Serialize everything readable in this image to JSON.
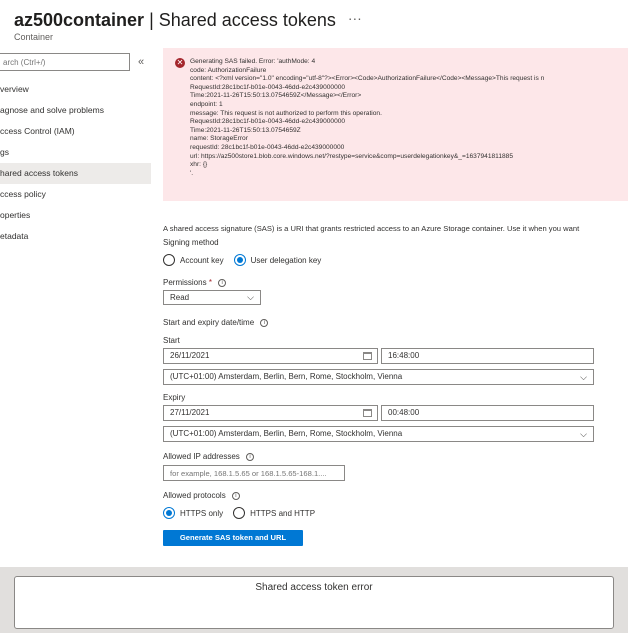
{
  "header": {
    "title": "az500container",
    "separator": "|",
    "page": "Shared access tokens",
    "more": "···",
    "subtitle": "Container"
  },
  "sidebar": {
    "search_placeholder": "arch (Ctrl+/)",
    "collapse": "«",
    "items": [
      {
        "label": "verview"
      },
      {
        "label": "agnose and solve problems"
      },
      {
        "label": "ccess Control (IAM)"
      },
      {
        "label": "gs"
      },
      {
        "label": "hared access tokens"
      },
      {
        "label": "ccess policy"
      },
      {
        "label": "operties"
      },
      {
        "label": "etadata"
      }
    ]
  },
  "error": {
    "icon": "error-circle-icon",
    "lines": [
      "Generating SAS failed. Error: 'authMode: 4",
      "code: AuthorizationFailure",
      "content: <?xml version=\"1.0\" encoding=\"utf-8\"?><Error><Code>AuthorizationFailure</Code><Message>This request is n",
      "RequestId:28c1bc1f-b01e-0043-46dd-e2c439000000",
      "Time:2021-11-26T15:50:13.0754659Z</Message></Error>",
      "endpoint: 1",
      "message: This request is not authorized to perform this operation.",
      "RequestId:28c1bc1f-b01e-0043-46dd-e2c439000000",
      "Time:2021-11-26T15:50:13.0754659Z",
      "name: StorageError",
      "requestId: 28c1bc1f-b01e-0043-46dd-e2c439000000",
      "url: https://az500store1.blob.core.windows.net/?restype=service&comp=userdelegationkey&_=1637941811885",
      "xhr: {}",
      "'."
    ]
  },
  "form": {
    "description": "A shared access signature (SAS) is a URI that grants restricted access to an Azure Storage container. Use it when you want",
    "signing_method": {
      "label": "Signing method",
      "options": [
        "Account key",
        "User delegation key"
      ],
      "selected": "User delegation key"
    },
    "permissions": {
      "label": "Permissions",
      "required": "*",
      "value": "Read"
    },
    "date_time_label": "Start and expiry date/time",
    "start": {
      "label": "Start",
      "date": "26/11/2021",
      "time": "16:48:00",
      "timezone": "(UTC+01:00) Amsterdam, Berlin, Bern, Rome, Stockholm, Vienna"
    },
    "expiry": {
      "label": "Expiry",
      "date": "27/11/2021",
      "time": "00:48:00",
      "timezone": "(UTC+01:00) Amsterdam, Berlin, Bern, Rome, Stockholm, Vienna"
    },
    "allowed_ip": {
      "label": "Allowed IP addresses",
      "placeholder": "for example, 168.1.5.65 or 168.1.5.65-168.1...."
    },
    "allowed_protocols": {
      "label": "Allowed protocols",
      "options": [
        "HTTPS only",
        "HTTPS and HTTP"
      ],
      "selected": "HTTPS only"
    },
    "generate_button": "Generate SAS token and URL"
  },
  "dialog": {
    "title": "Shared access token error"
  },
  "colors": {
    "accent": "#0078d4",
    "error_bg": "#fde7e9",
    "error_icon": "#a4262c"
  }
}
